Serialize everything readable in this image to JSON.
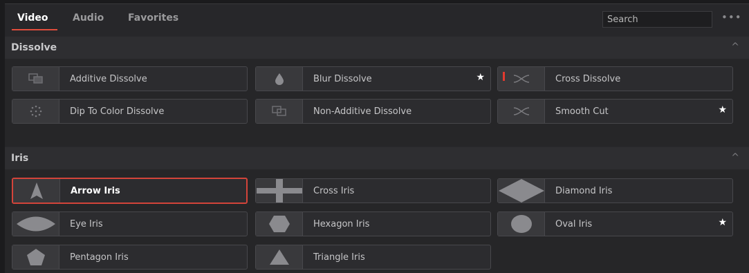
{
  "tabs": [
    {
      "label": "Video",
      "active": true
    },
    {
      "label": "Audio",
      "active": false
    },
    {
      "label": "Favorites",
      "active": false
    }
  ],
  "search": {
    "placeholder": "Search"
  },
  "more_glyph": "•••",
  "caret_glyph": "^",
  "star_glyph": "★",
  "accent_color": "#e14d3c",
  "sections": [
    {
      "title": "Dissolve",
      "items": [
        {
          "label": "Additive Dissolve",
          "icon": "additive-dissolve-icon",
          "favorite": false
        },
        {
          "label": "Blur Dissolve",
          "icon": "droplet-icon",
          "favorite": true
        },
        {
          "label": "Cross Dissolve",
          "icon": "cross-dissolve-icon",
          "favorite": false,
          "marked": true
        },
        {
          "label": "Dip To Color Dissolve",
          "icon": "dots-circle-icon",
          "favorite": false
        },
        {
          "label": "Non-Additive Dissolve",
          "icon": "non-additive-dissolve-icon",
          "favorite": false
        },
        {
          "label": "Smooth Cut",
          "icon": "smooth-cut-icon",
          "favorite": true
        }
      ]
    },
    {
      "title": "Iris",
      "items": [
        {
          "label": "Arrow Iris",
          "icon": "arrow-iris-icon",
          "favorite": false,
          "selected": true
        },
        {
          "label": "Cross Iris",
          "icon": "cross-iris-icon",
          "favorite": false
        },
        {
          "label": "Diamond Iris",
          "icon": "diamond-iris-icon",
          "favorite": false
        },
        {
          "label": "Eye Iris",
          "icon": "eye-iris-icon",
          "favorite": false
        },
        {
          "label": "Hexagon Iris",
          "icon": "hexagon-iris-icon",
          "favorite": false
        },
        {
          "label": "Oval Iris",
          "icon": "oval-iris-icon",
          "favorite": true
        },
        {
          "label": "Pentagon Iris",
          "icon": "pentagon-iris-icon",
          "favorite": false
        },
        {
          "label": "Triangle Iris",
          "icon": "triangle-iris-icon",
          "favorite": false
        }
      ]
    }
  ]
}
